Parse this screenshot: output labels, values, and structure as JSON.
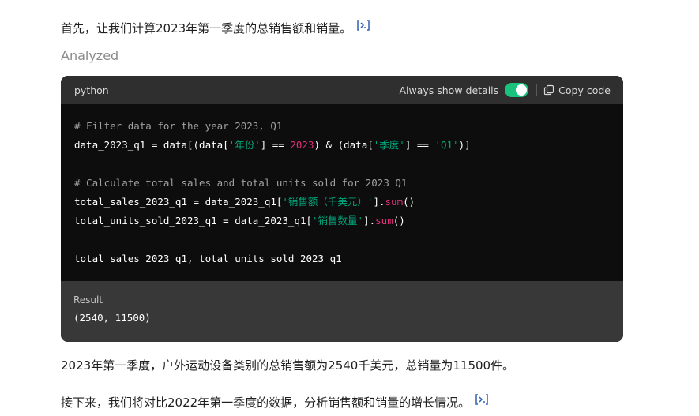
{
  "messages": {
    "intro": "首先，让我们计算2023年第一季度的总销售额和销量。",
    "analyzed_label": "Analyzed",
    "summary": "2023年第一季度，户外运动设备类别的总销售额为2540千美元，总销量为11500件。",
    "next": "接下来，我们将对比2022年第一季度的数据，分析销售额和销量的增长情况。"
  },
  "code_block": {
    "language": "python",
    "toggle_label": "Always show details",
    "toggle_on": true,
    "copy_label": "Copy code",
    "lines": [
      {
        "tokens": [
          {
            "t": "# Filter data for the year 2023, Q1",
            "c": "comment"
          }
        ]
      },
      {
        "tokens": [
          {
            "t": "data_2023_q1 = data[(data[",
            "c": "plain"
          },
          {
            "t": "'年份'",
            "c": "str"
          },
          {
            "t": "] == ",
            "c": "plain"
          },
          {
            "t": "2023",
            "c": "num"
          },
          {
            "t": ") & (data[",
            "c": "plain"
          },
          {
            "t": "'季度'",
            "c": "str"
          },
          {
            "t": "] == ",
            "c": "plain"
          },
          {
            "t": "'Q1'",
            "c": "str"
          },
          {
            "t": ")]",
            "c": "plain"
          }
        ]
      },
      {
        "tokens": []
      },
      {
        "tokens": [
          {
            "t": "# Calculate total sales and total units sold for 2023 Q1",
            "c": "comment"
          }
        ]
      },
      {
        "tokens": [
          {
            "t": "total_sales_2023_q1 = data_2023_q1[",
            "c": "plain"
          },
          {
            "t": "'销售额（千美元）'",
            "c": "str"
          },
          {
            "t": "].",
            "c": "plain"
          },
          {
            "t": "sum",
            "c": "fn"
          },
          {
            "t": "()",
            "c": "plain"
          }
        ]
      },
      {
        "tokens": [
          {
            "t": "total_units_sold_2023_q1 = data_2023_q1[",
            "c": "plain"
          },
          {
            "t": "'销售数量'",
            "c": "str"
          },
          {
            "t": "].",
            "c": "plain"
          },
          {
            "t": "sum",
            "c": "fn"
          },
          {
            "t": "()",
            "c": "plain"
          }
        ]
      },
      {
        "tokens": []
      },
      {
        "tokens": [
          {
            "t": "total_sales_2023_q1, total_units_sold_2023_q1",
            "c": "plain"
          }
        ]
      }
    ],
    "result_label": "Result",
    "result_value": "(2540, 11500)"
  },
  "colors": {
    "accent_toggle": "#19c37d",
    "string": "#00a67d",
    "number": "#df3079",
    "comment": "#a0a0a0",
    "citation_icon": "#2f5fb3"
  },
  "icons": [
    "citation-icon",
    "copy-icon"
  ]
}
